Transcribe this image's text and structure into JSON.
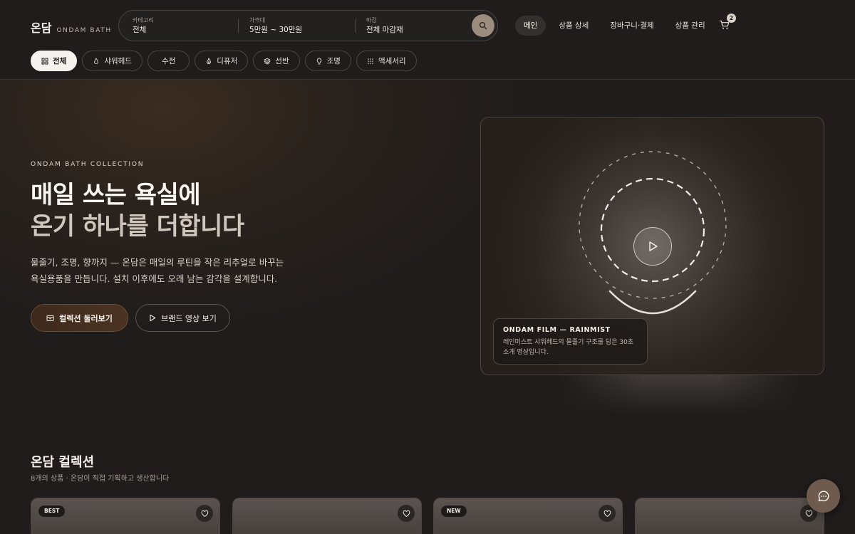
{
  "brand": {
    "name_ko": "온담",
    "name_en": "ONDAM BATH"
  },
  "search": {
    "category": {
      "label": "카테고리",
      "value": "전체"
    },
    "price": {
      "label": "가격대",
      "value": "5만원 ~ 30만원"
    },
    "finish": {
      "label": "마감",
      "value": "전체 마감재"
    }
  },
  "nav": {
    "items": [
      {
        "label": "메인",
        "active": true
      },
      {
        "label": "상품 상세"
      },
      {
        "label": "장바구니·결제"
      },
      {
        "label": "상품 관리"
      }
    ],
    "cart_count": "2"
  },
  "chips": [
    {
      "label": "전체",
      "icon": "grid-icon",
      "active": true
    },
    {
      "label": "샤워헤드",
      "icon": "drop-icon"
    },
    {
      "label": "수전",
      "icon": ""
    },
    {
      "label": "디퓨저",
      "icon": "flame-icon"
    },
    {
      "label": "선반",
      "icon": "layers-icon"
    },
    {
      "label": "조명",
      "icon": "bulb-icon"
    },
    {
      "label": "액세서리",
      "icon": "dots-icon"
    }
  ],
  "hero": {
    "eyebrow": "ONDAM BATH COLLECTION",
    "title_line1": "매일 쓰는 욕실에",
    "title_line2": "온기 하나를 더합니다",
    "description": "물줄기, 조명, 향까지 — 온담은 매일의 루틴을 작은 리추얼로 바꾸는 욕실용품을 만듭니다. 설치 이후에도 오래 남는 감각을 설계합니다.",
    "primary_button": "컬렉션 둘러보기",
    "secondary_button": "브랜드 영상 보기",
    "video": {
      "caption_title": "ONDAM FILM — RAINMIST",
      "caption_text": "레인미스트 샤워헤드의 물줄기 구조를 담은 30초 소개 영상입니다."
    }
  },
  "collection": {
    "title": "온담 컬렉션",
    "subtitle": "8개의 상품 · 온담이 직접 기획하고 생산합니다",
    "cards": [
      {
        "badge": "BEST"
      },
      {
        "badge": ""
      },
      {
        "badge": "NEW"
      },
      {
        "badge": ""
      }
    ]
  },
  "colors": {
    "background": "#1f1c1b",
    "accent": "#6e5b4d",
    "chip_active": "#f6f3ef"
  }
}
